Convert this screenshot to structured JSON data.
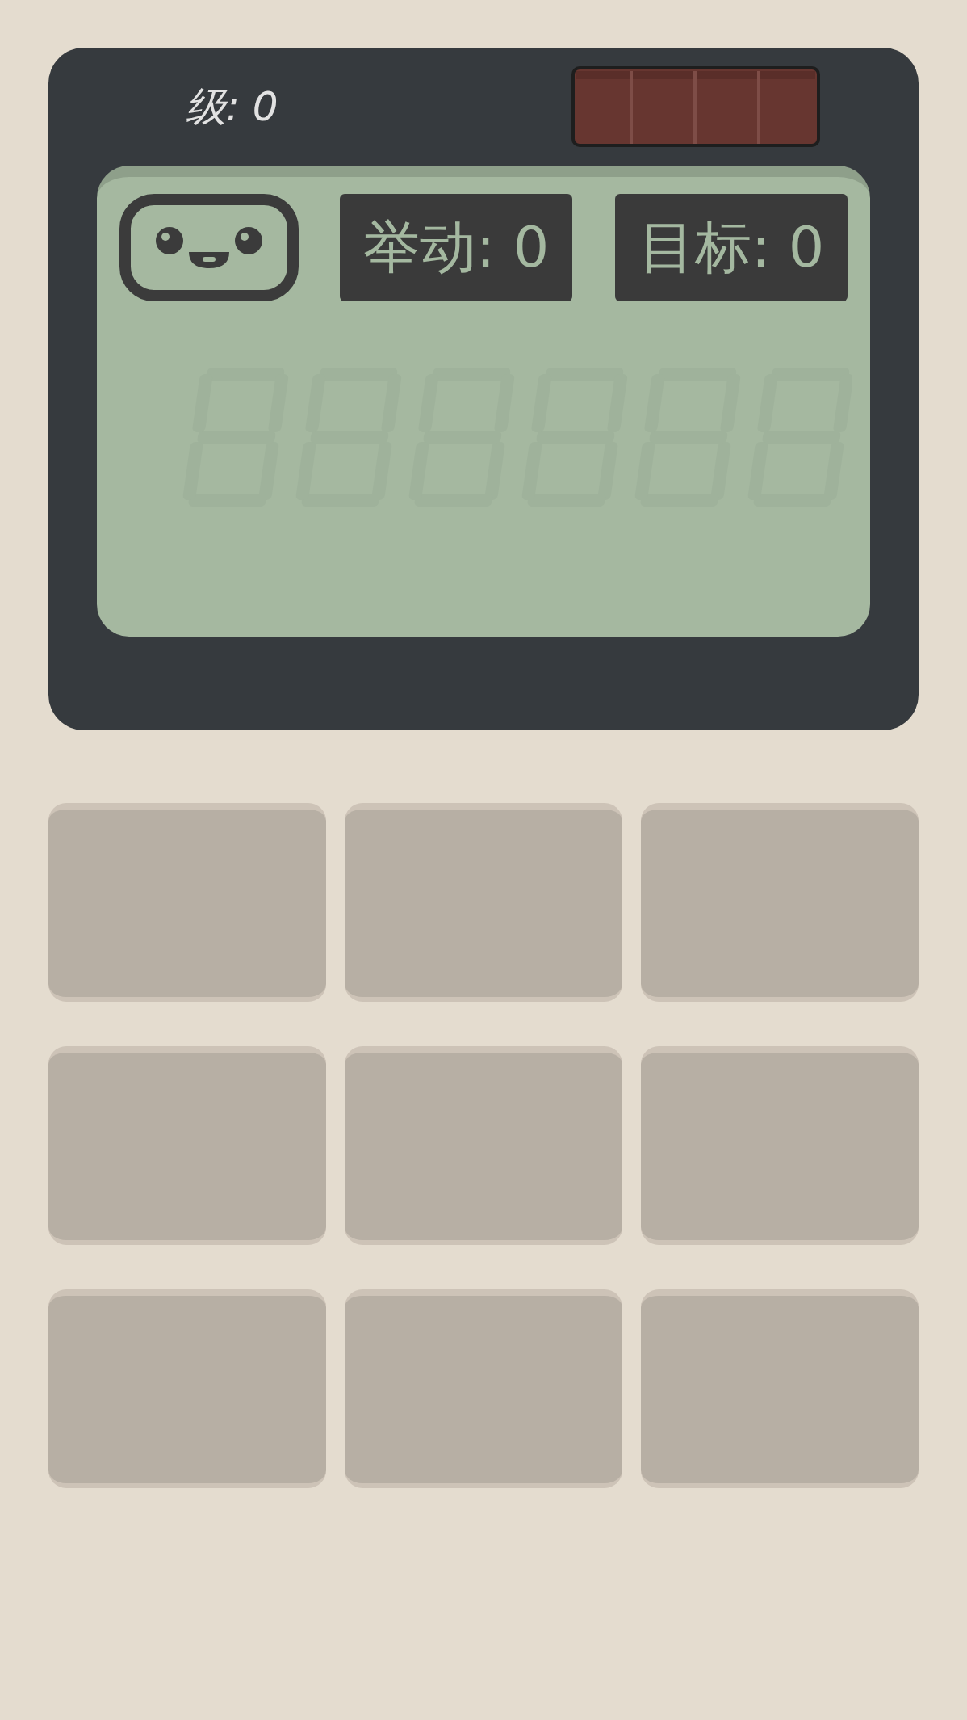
{
  "level_label": "级: 0",
  "moves": "举动: 0",
  "target": "目标: 0",
  "keypad": [
    {
      "kind": "blank"
    },
    {
      "kind": "blank"
    },
    {
      "kind": "blank"
    },
    {
      "kind": "blank"
    },
    {
      "kind": "blank"
    },
    {
      "kind": "blank"
    },
    {
      "kind": "blank"
    },
    {
      "kind": "blank"
    },
    {
      "kind": "blank"
    }
  ]
}
